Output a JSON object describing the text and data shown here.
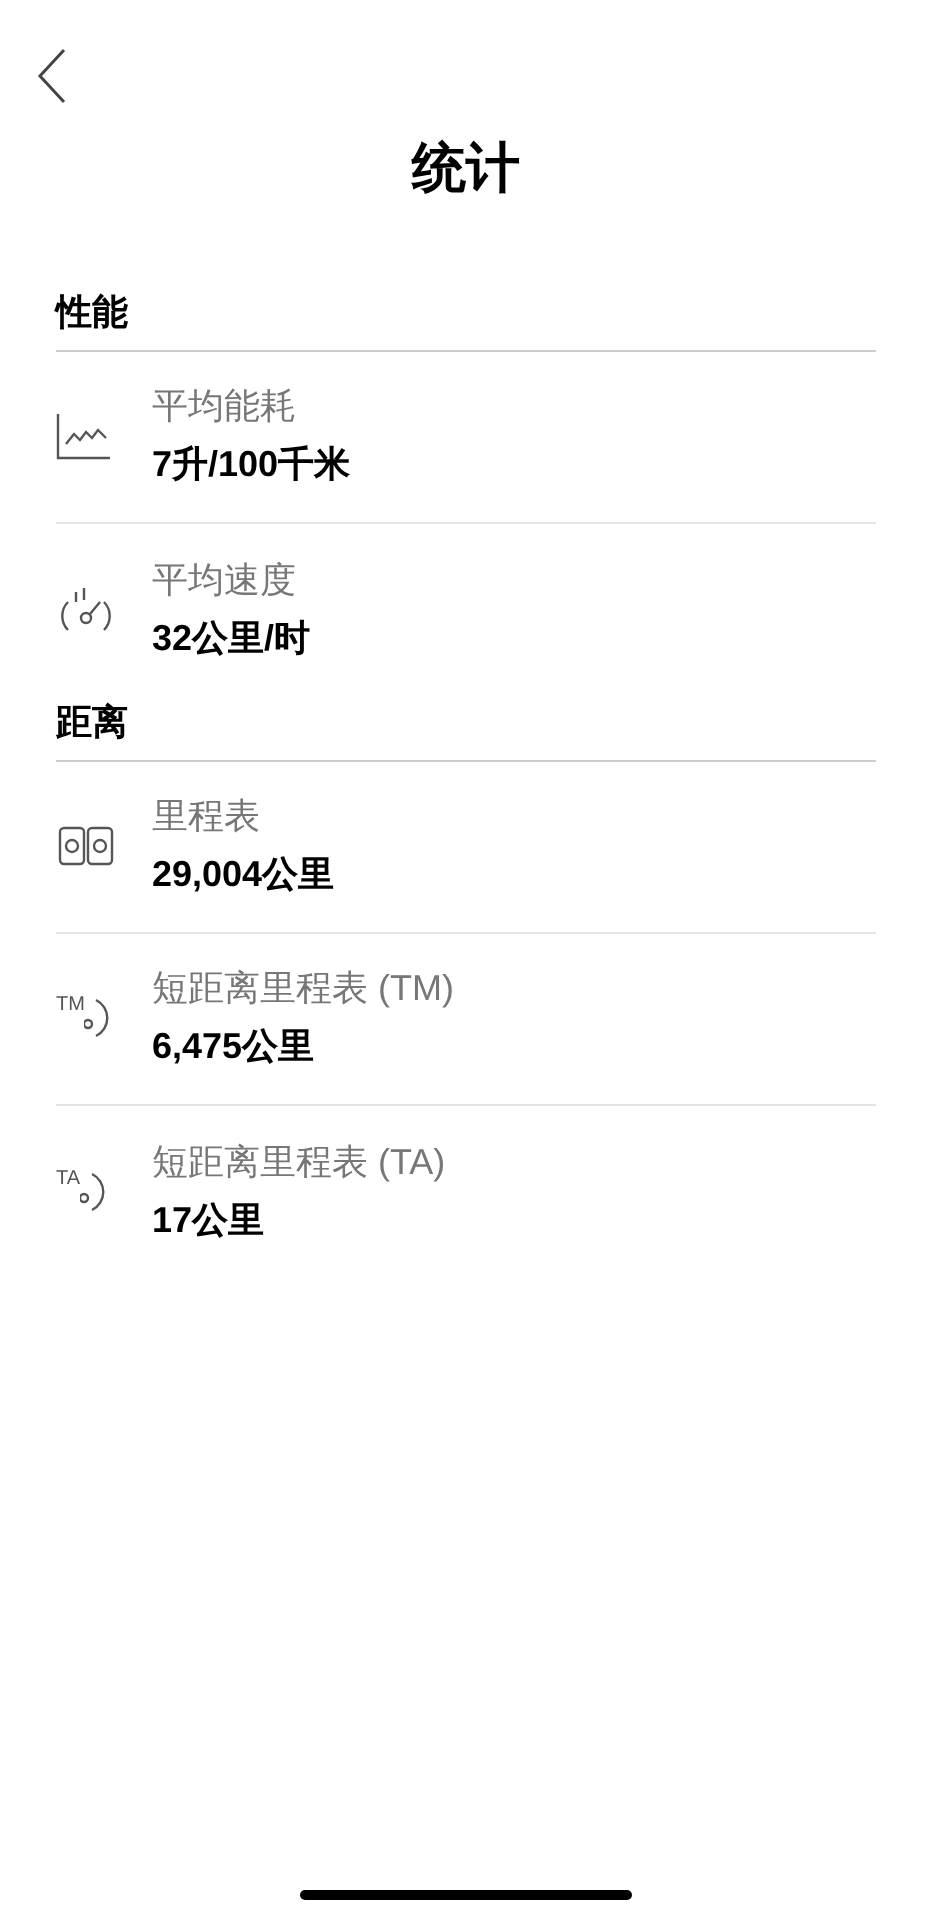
{
  "title": "统计",
  "sections": [
    {
      "heading": "性能",
      "rows": [
        {
          "kind": "chart",
          "label": "平均能耗",
          "value": "7升/100千米"
        },
        {
          "kind": "gauge",
          "label": "平均速度",
          "value": "32公里/时"
        }
      ]
    },
    {
      "heading": "距离",
      "rows": [
        {
          "kind": "odometer",
          "label": "里程表",
          "value": "29,004公里"
        },
        {
          "kind": "trip",
          "badge": "TM",
          "label": "短距离里程表 (TM)",
          "value": "6,475公里"
        },
        {
          "kind": "trip",
          "badge": "TA",
          "label": "短距离里程表 (TA)",
          "value": "17公里"
        }
      ]
    }
  ]
}
